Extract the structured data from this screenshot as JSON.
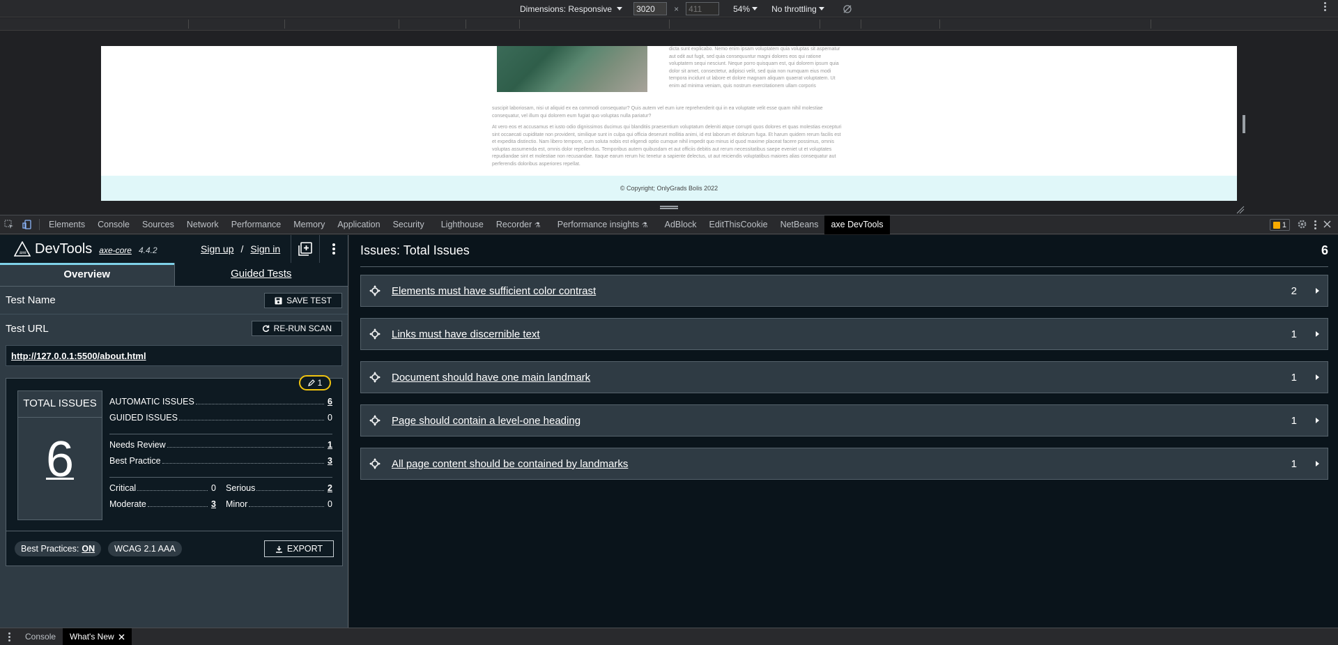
{
  "device_toolbar": {
    "dimensions_label": "Dimensions: Responsive",
    "width_value": "3020",
    "times": "×",
    "height_value": "411",
    "zoom": "54%",
    "throttle": "No throttling"
  },
  "page_preview": {
    "lorem_right": "dicta sunt explicabo. Nemo enim ipsam voluptatem quia voluptas sit aspernatur aut odit aut fugit, sed quia consequuntur magni dolores eos qui ratione voluptatem sequi nesciunt. Neque porro quisquam est, qui dolorem ipsum quia dolor sit amet, consectetur, adipisci velit, sed quia non numquam eius modi tempora incidunt ut labore et dolore magnam aliquam quaerat voluptatem. Ut enim ad minima veniam, quis nostrum exercitationem ullam corporis",
    "lorem_wide": "suscipit laboriosam, nisi ut aliquid ex ea commodi consequatur? Quis autem vel eum iure reprehenderit qui in ea voluptate velit esse quam nihil molestiae consequatur, vel illum qui dolorem eum fugiat quo voluptas nulla pariatur?",
    "lorem_para2": "At vero eos et accusamus et iusto odio dignissimos ducimus qui blanditiis praesentium voluptatum deleniti atque corrupti quos dolores et quas molestias excepturi sint occaecati cupiditate non provident, similique sunt in culpa qui officia deserunt mollitia animi, id est laborum et dolorum fuga. Et harum quidem rerum facilis est et expedita distinctio. Nam libero tempore, cum soluta nobis est eligendi optio cumque nihil impedit quo minus id quod maxime placeat facere possimus, omnis voluptas assumenda est, omnis dolor repellendus. Temporibus autem quibusdam et aut officiis debitis aut rerum necessitatibus saepe eveniet ut et voluptates repudiandae sint et molestiae non recusandae. Itaque earum rerum hic tenetur a sapiente delectus, ut aut reiciendis voluptatibus maiores alias consequatur aut perferendis doloribus asperiores repellat.",
    "footer": "© Copyright; OnlyGrads Bolis 2022"
  },
  "devtools_tabs": [
    "Elements",
    "Console",
    "Sources",
    "Network",
    "Performance",
    "Memory",
    "Application",
    "Security",
    "Lighthouse",
    "Recorder",
    "Performance insights",
    "AdBlock",
    "EditThisCookie",
    "NetBeans",
    "axe DevTools"
  ],
  "devtools_right": {
    "issues_count": "1"
  },
  "axe": {
    "title": "DevTools",
    "core": "axe-core",
    "version": "4.4.2",
    "sign_up": "Sign up",
    "slash": "/",
    "sign_in": "Sign in",
    "tabs": {
      "overview": "Overview",
      "guided": "Guided Tests"
    },
    "test_name_label": "Test Name",
    "save_test": "SAVE TEST",
    "test_url_label": "Test URL",
    "rerun": "RE-RUN SCAN",
    "url": "http://127.0.0.1:5500/about.html",
    "pencil_count": "1",
    "total_label": "TOTAL ISSUES",
    "total": "6",
    "stats": {
      "automatic": {
        "label": "AUTOMATIC ISSUES",
        "value": "6"
      },
      "guided": {
        "label": "GUIDED ISSUES",
        "value": "0"
      },
      "needs_review": {
        "label": "Needs Review",
        "value": "1"
      },
      "best_practice": {
        "label": "Best Practice",
        "value": "3"
      },
      "critical": {
        "label": "Critical",
        "value": "0"
      },
      "serious": {
        "label": "Serious",
        "value": "2"
      },
      "moderate": {
        "label": "Moderate",
        "value": "3"
      },
      "minor": {
        "label": "Minor",
        "value": "0"
      }
    },
    "best_practices_label": "Best Practices:",
    "best_practices_value": "ON",
    "wcag": "WCAG 2.1 AAA",
    "export": "EXPORT",
    "issues_title": "Issues: Total Issues",
    "issues_total": "6",
    "issues": [
      {
        "title": "Elements must have sufficient color contrast",
        "count": "2"
      },
      {
        "title": "Links must have discernible text",
        "count": "1"
      },
      {
        "title": "Document should have one main landmark",
        "count": "1"
      },
      {
        "title": "Page should contain a level-one heading",
        "count": "1"
      },
      {
        "title": "All page content should be contained by landmarks",
        "count": "1"
      }
    ]
  },
  "drawer": {
    "console": "Console",
    "whats_new": "What's New"
  },
  "colors": {
    "accent": "#7fd1e8",
    "pill_border": "#f1c40f",
    "panel": "#2f3b44",
    "dark": "#0e1a22"
  }
}
